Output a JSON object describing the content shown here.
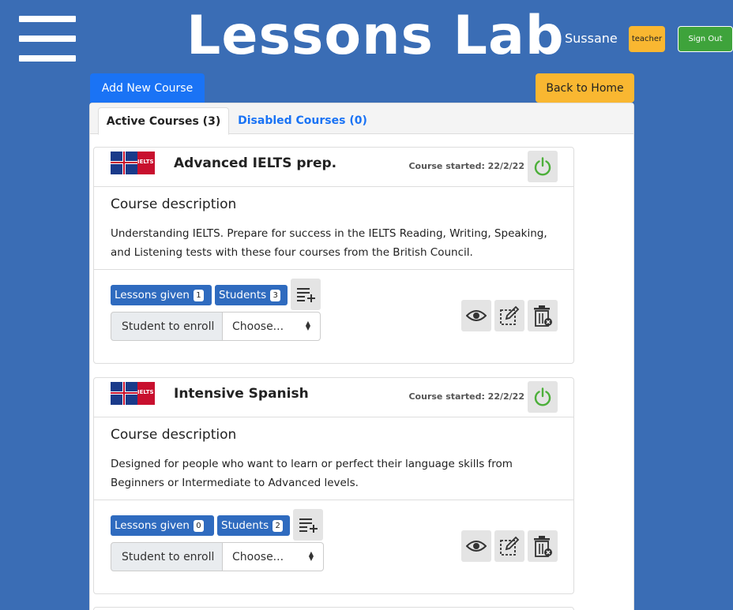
{
  "header": {
    "app_title": "Lessons Lab",
    "username": "Sussane",
    "role": "teacher",
    "signout_label": "Sign Out"
  },
  "toolbar": {
    "add_label": "Add New Course",
    "home_label": "Back to Home"
  },
  "tabs": [
    {
      "label": "Active Courses (3)"
    },
    {
      "label": "Disabled Courses (0)"
    }
  ],
  "courses": [
    {
      "flag_text": "IELTS",
      "title": "Advanced IELTS prep.",
      "started": "Course started: 22/2/22",
      "desc_title": "Course description",
      "description": "Understanding IELTS. Prepare for success in the IELTS Reading, Writing, Speaking, and Listening tests with these four courses from the British Council.",
      "lessons_label": "Lessons given",
      "lessons_count": "1",
      "students_label": "Students",
      "students_count": "3",
      "enroll_label": "Student to enroll",
      "enroll_value": "Choose..."
    },
    {
      "flag_text": "IELTS",
      "title": "Intensive Spanish",
      "started": "Course started: 22/2/22",
      "desc_title": "Course description",
      "description": "Designed for people who want to learn or perfect their language skills from Beginners or Intermediate to Advanced levels.",
      "lessons_label": "Lessons given",
      "lessons_count": "0",
      "students_label": "Students",
      "students_count": "2",
      "enroll_label": "Student to enroll",
      "enroll_value": "Choose..."
    }
  ],
  "colors": {
    "background": "#3a6db5",
    "primary": "#1a73f5",
    "warning": "#f9b731",
    "success": "#3ea33b",
    "badge": "#2f6bbf",
    "power": "#4caf3a"
  },
  "icons": [
    "menu-icon",
    "power-icon",
    "playlist-add-icon",
    "eye-icon",
    "edit-icon",
    "trash-icon"
  ]
}
